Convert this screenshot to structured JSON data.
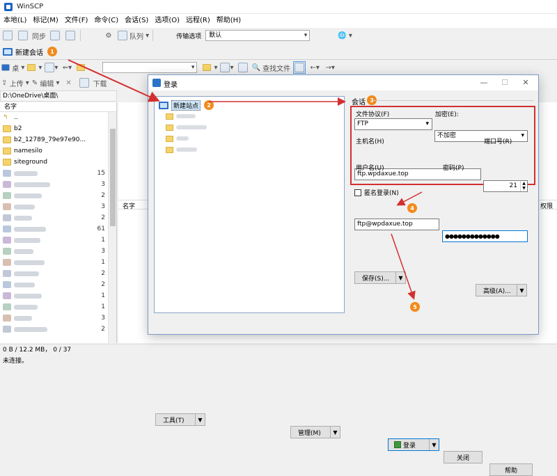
{
  "app": {
    "title": "WinSCP"
  },
  "menu": [
    "本地(L)",
    "标记(M)",
    "文件(F)",
    "命令(C)",
    "会话(S)",
    "选项(O)",
    "远程(R)",
    "帮助(H)"
  ],
  "toolbar1": {
    "sync_label": "同步",
    "queue_label": "队列",
    "transfer_label": "传输选项",
    "transfer_value": "默认"
  },
  "tab": {
    "new_session": "新建会话"
  },
  "toolbar2": {
    "desktop_label": "桌",
    "find_label": "查找文件"
  },
  "toolbar3": {
    "upload_label": "上传",
    "edit_label": "编辑",
    "download_label": "下载"
  },
  "left_panel": {
    "path": "D:\\OneDrive\\桌面\\",
    "name_header": "名字",
    "files": [
      {
        "name": "..",
        "kind": "parent"
      },
      {
        "name": "b2",
        "kind": "folder"
      },
      {
        "name": "b2_12789_79e97e90...",
        "kind": "folder"
      },
      {
        "name": "namesilo",
        "kind": "folder"
      },
      {
        "name": "siteground",
        "kind": "folder"
      }
    ],
    "sizes": [
      "15",
      "3",
      "2",
      "3",
      "2",
      "61",
      "1",
      "3",
      "1",
      "2",
      "2",
      "1",
      "1",
      "3",
      "2"
    ]
  },
  "right_panel": {
    "name_header": "名字",
    "rights_header": "权限"
  },
  "status": {
    "size_line": "0 B / 12.2 MB，  0 / 37",
    "connection": "未连接。"
  },
  "dialog": {
    "title": "登录",
    "minimize": "—",
    "maximize": "☐",
    "close": "✕",
    "new_site": "新建站点",
    "session_label": "会话",
    "protocol_label": "文件协议(F)",
    "protocol_value": "FTP",
    "encryption_label": "加密(E):",
    "encryption_value": "不加密",
    "host_label": "主机名(H)",
    "host_value": "ftp.wpdaxue.top",
    "port_label": "端口号(R)",
    "port_value": "21",
    "user_label": "用户名(U)",
    "user_value": "ftp@wpdaxue.top",
    "password_label": "密码(P)",
    "password_value": "●●●●●●●●●●●●●",
    "anon_label": "匿名登录(N)",
    "save_label": "保存(S)...",
    "advanced_label": "高级(A)...",
    "tools_label": "工具(T)",
    "manage_label": "管理(M)",
    "login_label": "登录",
    "close_label": "关闭",
    "help_label": "帮助"
  },
  "annotations": [
    "1",
    "2",
    "3",
    "4",
    "5"
  ],
  "colors": {
    "accent": "#0078d7",
    "highlight_red": "#d32f2f",
    "badge": "#f28a1b"
  }
}
